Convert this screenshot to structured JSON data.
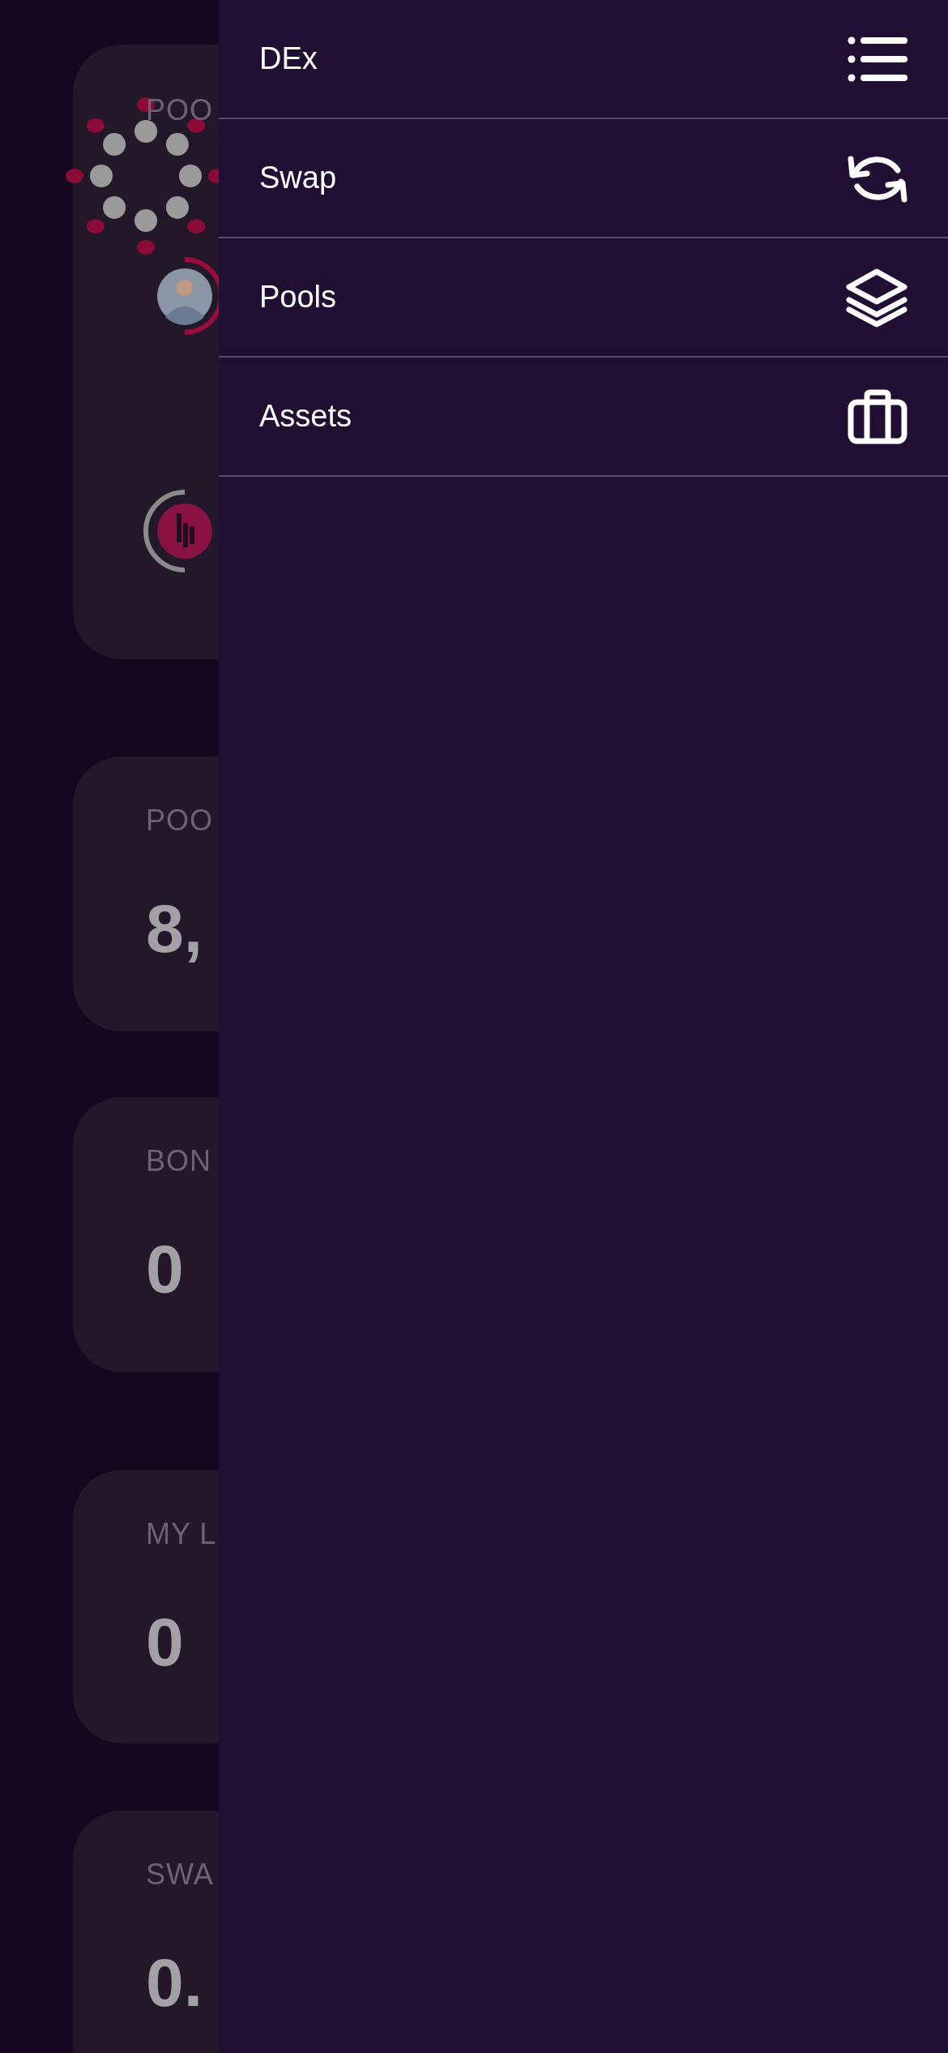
{
  "background_cards": [
    {
      "kind": "loading",
      "title": "POO"
    },
    {
      "kind": "stat",
      "title": "POO",
      "value": "8,"
    },
    {
      "kind": "stat",
      "title": "BON",
      "value": "0"
    },
    {
      "kind": "stat",
      "title": "MY L",
      "value": "0"
    },
    {
      "kind": "stat",
      "title": "SWA",
      "value": "0."
    }
  ],
  "menu": {
    "items": [
      {
        "kind": "list",
        "label": "DEx"
      },
      {
        "kind": "swap",
        "label": "Swap"
      },
      {
        "kind": "layers",
        "label": "Pools"
      },
      {
        "kind": "briefcase",
        "label": "Assets"
      }
    ]
  }
}
